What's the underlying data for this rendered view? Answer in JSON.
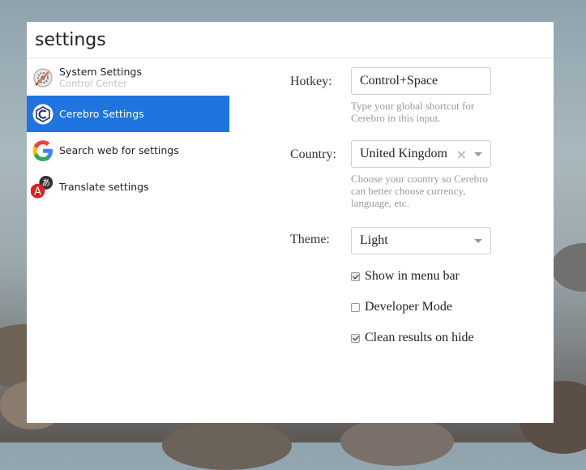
{
  "search": {
    "value": "settings"
  },
  "results": [
    {
      "title": "System Settings",
      "subtitle": "Control Center",
      "icon": "system-settings-icon"
    },
    {
      "title": "Cerebro Settings",
      "subtitle": "",
      "icon": "cerebro-icon",
      "selected": true
    },
    {
      "title": "Search web for settings",
      "subtitle": "",
      "icon": "google-icon"
    },
    {
      "title": "Translate settings",
      "subtitle": "",
      "icon": "translate-icon"
    }
  ],
  "settings": {
    "hotkey": {
      "label": "Hotkey:",
      "value": "Control+Space",
      "hint": "Type your global shortcut for Cerebro in this input."
    },
    "country": {
      "label": "Country:",
      "value": "United Kingdom",
      "clear": "×",
      "hint": "Choose your country so Cerebro can better choose currency, language, etc."
    },
    "theme": {
      "label": "Theme:",
      "value": "Light"
    },
    "checkboxes": [
      {
        "label": "Show in menu bar",
        "checked": true
      },
      {
        "label": "Developer Mode",
        "checked": false
      },
      {
        "label": "Clean results on hide",
        "checked": true
      }
    ]
  },
  "colors": {
    "accent": "#1f74e0",
    "window": "#ffffff"
  }
}
